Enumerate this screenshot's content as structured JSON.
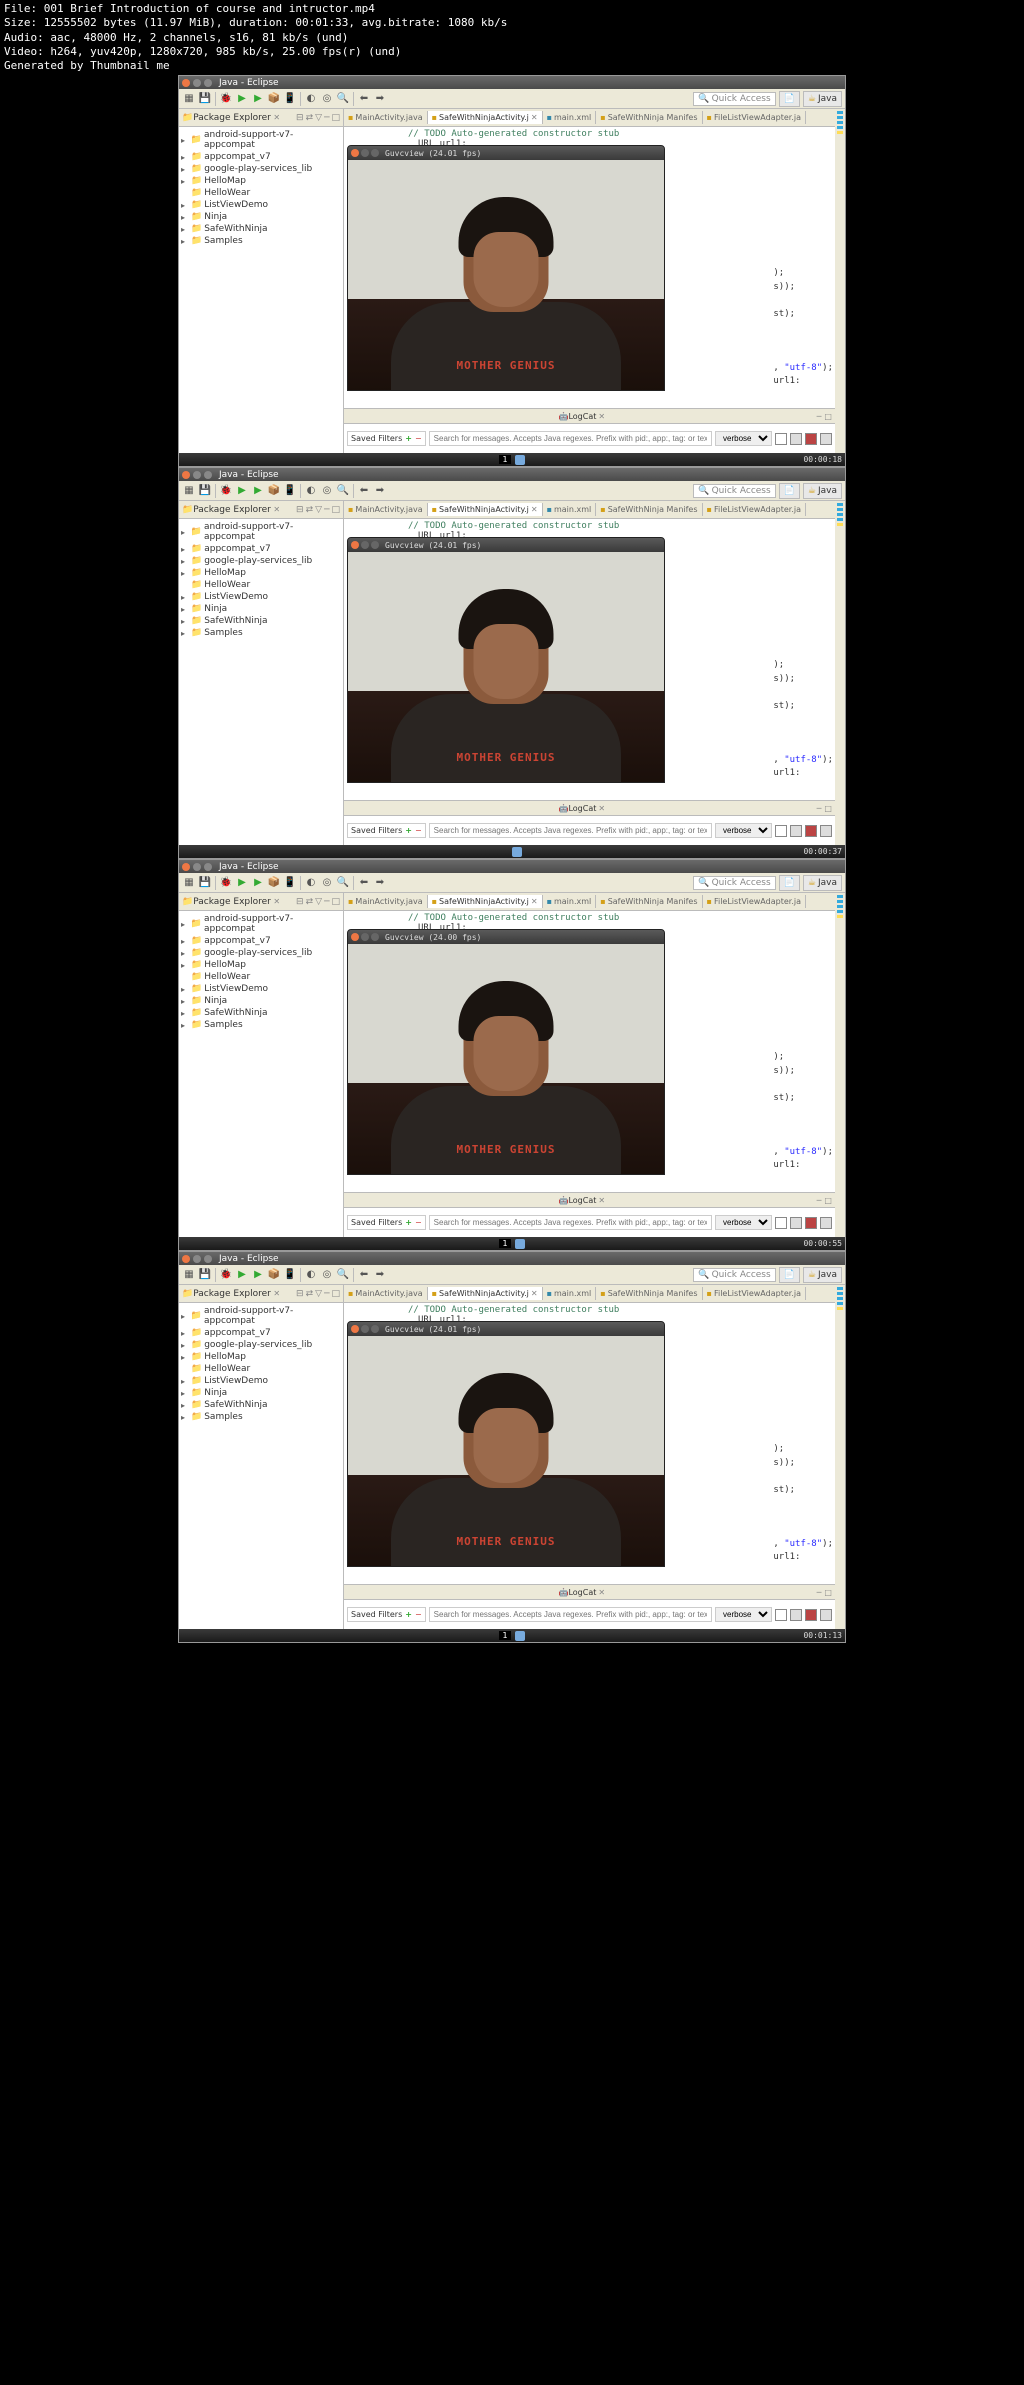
{
  "header": {
    "file": "File: 001 Brief Introduction of course and intructor.mp4",
    "size": "Size: 12555502 bytes (11.97 MiB), duration: 00:01:33, avg.bitrate: 1080 kb/s",
    "audio": "Audio: aac, 48000 Hz, 2 channels, s16, 81 kb/s (und)",
    "video": "Video: h264, yuv420p, 1280x720, 985 kb/s, 25.00 fps(r) (und)",
    "gen": "Generated by Thumbnail me"
  },
  "titlebar": "Java - Eclipse",
  "quick_access": "Quick Access",
  "perspective": "Java",
  "package_explorer": "Package Explorer",
  "tree": [
    "android-support-v7-appcompat",
    "appcompat_v7",
    "google-play-services_lib",
    "HelloMap",
    "HelloWear",
    "ListViewDemo",
    "Ninja",
    "SafeWithNinja",
    "Samples"
  ],
  "tabs": [
    "MainActivity.java",
    "SafeWithNinjaActivity.j",
    "main.xml",
    "SafeWithNinja Manifes",
    "FileListViewAdapter.ja"
  ],
  "code_comment": "// TODO Auto-generated constructor stub",
  "code_url": "URL url1:",
  "video_title": "Guvcview  (24.01 fps)",
  "video_title2": "Guvcview  (24.00 fps)",
  "shirt": "MOTHER GENIUS",
  "snippets": {
    "l1": ");",
    "l2": "s));",
    "l3": "st);",
    "l4": ", \"utf-8\");",
    "l5": "url1:"
  },
  "logcat": "LogCat",
  "saved_filters": "Saved Filters",
  "search_placeholder": "Search for messages. Accepts Java regexes. Prefix with pid:, app:, tag: or text: to li",
  "verbose": "verbose",
  "timestamps": [
    "00:00:18",
    "00:00:37",
    "00:00:55",
    "00:01:13"
  ],
  "bottom_boxes": [
    "1",
    "",
    "1",
    "1"
  ]
}
